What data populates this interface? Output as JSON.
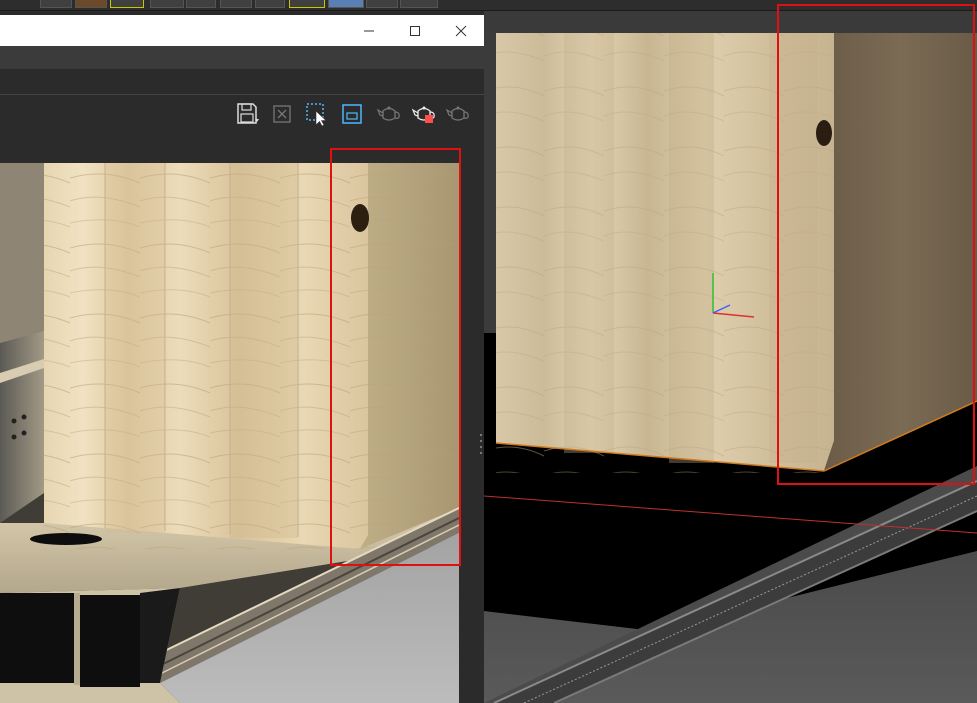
{
  "host_toolbar": {
    "buttons": [
      "gear-icon",
      "cube-icon",
      "select-icon",
      "move-icon",
      "rotate-icon",
      "light-icon",
      "link-icon",
      "camera-icon",
      "layout-icon",
      "view-icon",
      "render-icon"
    ]
  },
  "frame_buffer": {
    "title": "",
    "window_controls": [
      "minimize",
      "maximize",
      "close"
    ],
    "toolbar": [
      {
        "name": "save-image",
        "icon": "save-icon"
      },
      {
        "name": "clear-image",
        "icon": "clear-icon"
      },
      {
        "name": "region-render",
        "icon": "region-select-icon"
      },
      {
        "name": "track-mouse",
        "icon": "frame-icon"
      },
      {
        "name": "render-interactive",
        "icon": "teapot-icon"
      },
      {
        "name": "render-stop",
        "icon": "teapot-stop-icon"
      },
      {
        "name": "render-last",
        "icon": "teapot-icon"
      }
    ]
  },
  "colors": {
    "annotation": "#e01010",
    "axis_x": "#e03030",
    "axis_y": "#30c030",
    "axis_z": "#4060ff",
    "selection_edge": "#d07a20"
  }
}
